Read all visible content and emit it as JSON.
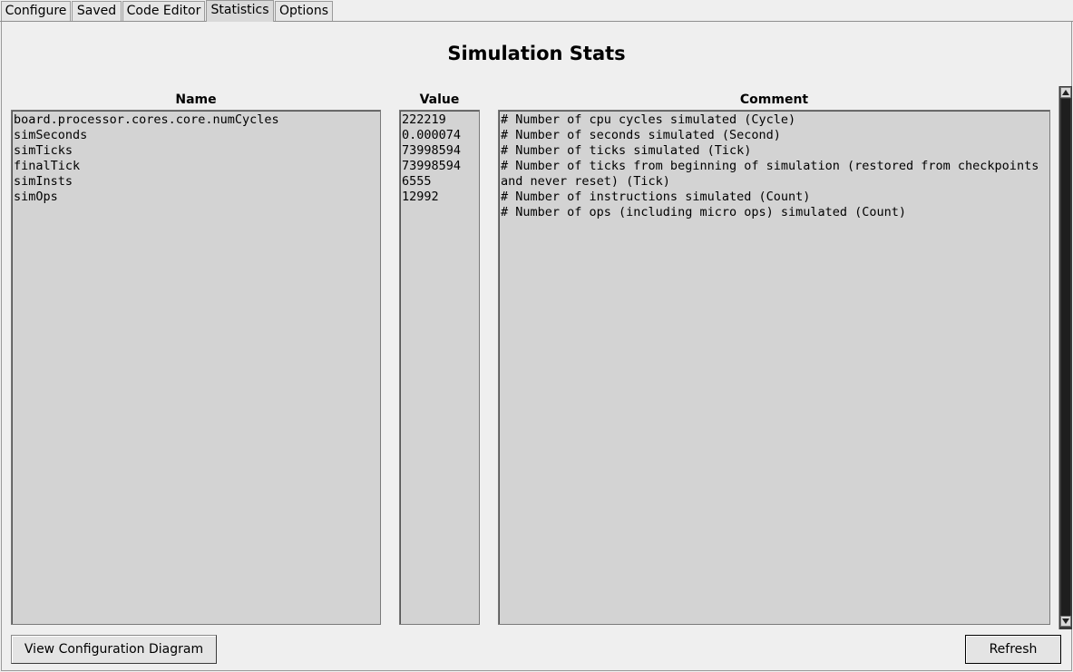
{
  "tabs": [
    {
      "label": "Configure"
    },
    {
      "label": "Saved"
    },
    {
      "label": "Code Editor"
    },
    {
      "label": "Statistics",
      "active": true
    },
    {
      "label": "Options"
    }
  ],
  "page": {
    "title": "Simulation Stats"
  },
  "columns": {
    "name": "Name",
    "value": "Value",
    "comment": "Comment"
  },
  "stats": [
    {
      "name": "board.processor.cores.core.numCycles",
      "value": "222219",
      "comment": "# Number of cpu cycles simulated (Cycle)"
    },
    {
      "name": "simSeconds",
      "value": "0.000074",
      "comment": "# Number of seconds simulated (Second)"
    },
    {
      "name": "simTicks",
      "value": "73998594",
      "comment": "# Number of ticks simulated (Tick)"
    },
    {
      "name": "finalTick",
      "value": "73998594",
      "comment": "# Number of ticks from beginning of simulation (restored from checkpoints and never reset) (Tick)"
    },
    {
      "name": "simInsts",
      "value": "6555",
      "comment": "# Number of instructions simulated (Count)"
    },
    {
      "name": "simOps",
      "value": "12992",
      "comment": "# Number of ops (including micro ops) simulated (Count)"
    }
  ],
  "buttons": {
    "view_config_diagram": "View Configuration Diagram",
    "refresh": "Refresh"
  },
  "icons": {
    "scroll_up": "triangle-up-icon",
    "scroll_down": "triangle-down-icon"
  }
}
